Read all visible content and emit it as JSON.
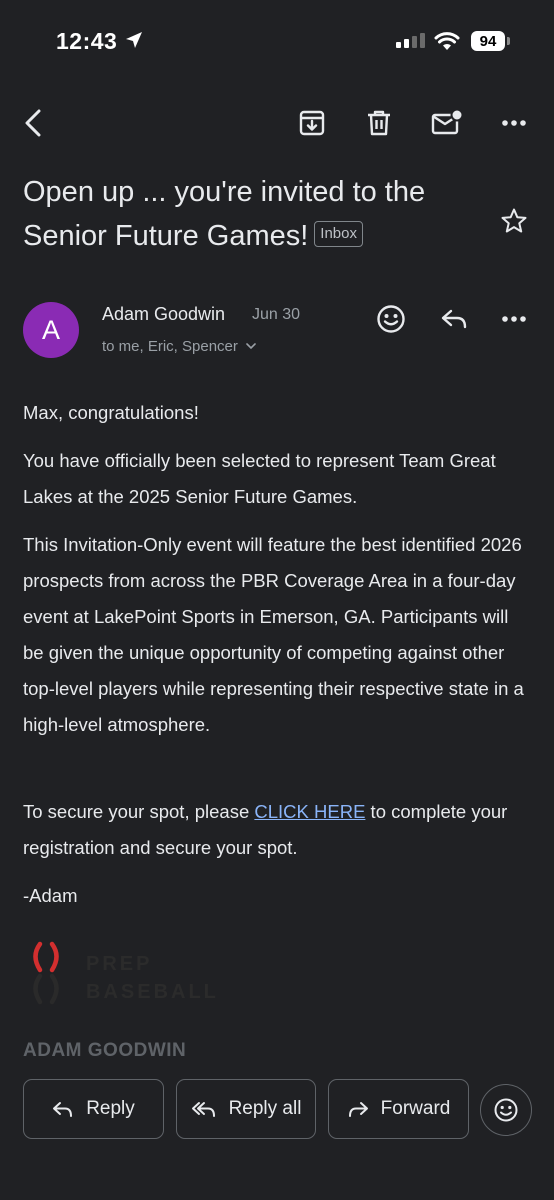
{
  "status_bar": {
    "time": "12:43",
    "battery": "94"
  },
  "toolbar": {
    "back_icon": "chevron-left-icon",
    "archive_icon": "archive-icon",
    "delete_icon": "trash-icon",
    "mark_unread_icon": "mail-dot-icon",
    "more_icon": "more-horizontal-icon"
  },
  "email": {
    "subject": "Open up ... you're invited to the Senior Future Games!",
    "label": "Inbox",
    "sender": {
      "initial": "A",
      "name": "Adam Goodwin",
      "date": "Jun 30",
      "recipients": "to me, Eric, Spencer",
      "avatar_color": "#8a2bb4"
    },
    "body": {
      "greeting": "Max, congratulations!",
      "para1": "You have officially been selected to represent Team Great Lakes at the 2025 Senior Future Games.",
      "para2": "This Invitation-Only event will feature the best identified 2026 prospects from across the PBR Coverage Area in a four-day event at LakePoint Sports in Emerson, GA. Participants will be given the unique opportunity of competing against other top-level players while representing their respective state in a high-level atmosphere.",
      "para3_before": "To secure your spot, please ",
      "para3_link": "CLICK HERE",
      "para3_after": " to complete your registration and secure your spot.",
      "signoff": "-Adam"
    },
    "signature": {
      "logo_line1": "PREP",
      "logo_line2": "BASEBALL",
      "name": "ADAM GOODWIN",
      "logo_color": "#d32f2f"
    }
  },
  "actions": {
    "reply": "Reply",
    "reply_all": "Reply all",
    "forward": "Forward"
  }
}
